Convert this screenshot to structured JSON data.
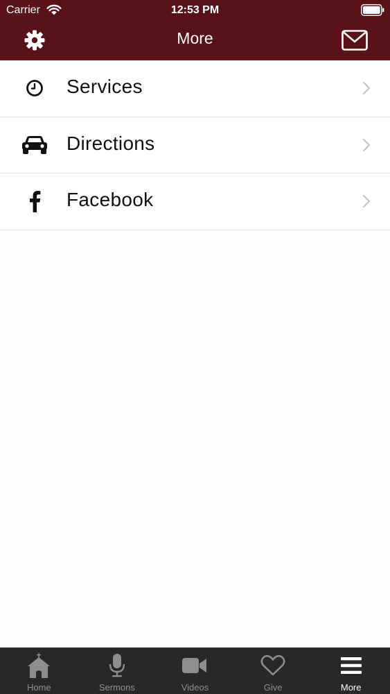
{
  "status_bar": {
    "carrier": "Carrier",
    "time": "12:53 PM"
  },
  "nav": {
    "title": "More",
    "left_icon": "gear-icon",
    "right_icon": "mail-icon"
  },
  "menu": {
    "items": [
      {
        "label": "Services",
        "icon": "clock-icon"
      },
      {
        "label": "Directions",
        "icon": "car-icon"
      },
      {
        "label": "Facebook",
        "icon": "facebook-icon"
      }
    ]
  },
  "tabs": {
    "items": [
      {
        "label": "Home",
        "icon": "church-icon",
        "active": false
      },
      {
        "label": "Sermons",
        "icon": "microphone-icon",
        "active": false
      },
      {
        "label": "Videos",
        "icon": "video-camera-icon",
        "active": false
      },
      {
        "label": "Give",
        "icon": "heart-icon",
        "active": false
      },
      {
        "label": "More",
        "icon": "menu-icon",
        "active": true
      }
    ]
  },
  "colors": {
    "header_bg": "#5a1219",
    "tabbar_bg": "#282828",
    "tab_inactive": "#8e8e8e",
    "tab_active": "#ffffff"
  }
}
